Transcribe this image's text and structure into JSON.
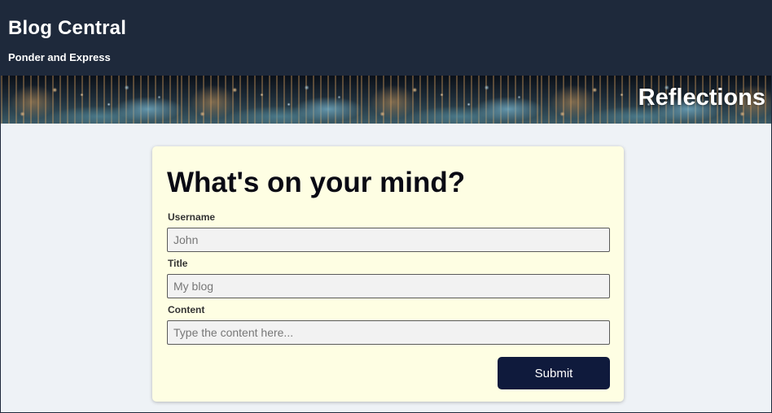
{
  "header": {
    "site_title": "Blog Central",
    "tagline": "Ponder and Express"
  },
  "banner": {
    "title": "Reflections",
    "image_icon": "city-lights-bokeh-image"
  },
  "form": {
    "heading": "What's on your mind?",
    "username": {
      "label": "Username",
      "placeholder": "John",
      "value": ""
    },
    "title": {
      "label": "Title",
      "placeholder": "My blog",
      "value": ""
    },
    "content": {
      "label": "Content",
      "placeholder": "Type the content here...",
      "value": ""
    },
    "submit_label": "Submit"
  },
  "colors": {
    "header_bg": "#1e293b",
    "page_bg": "#eef2f6",
    "card_bg": "#fefee3",
    "button_bg": "#0f1a3c"
  }
}
